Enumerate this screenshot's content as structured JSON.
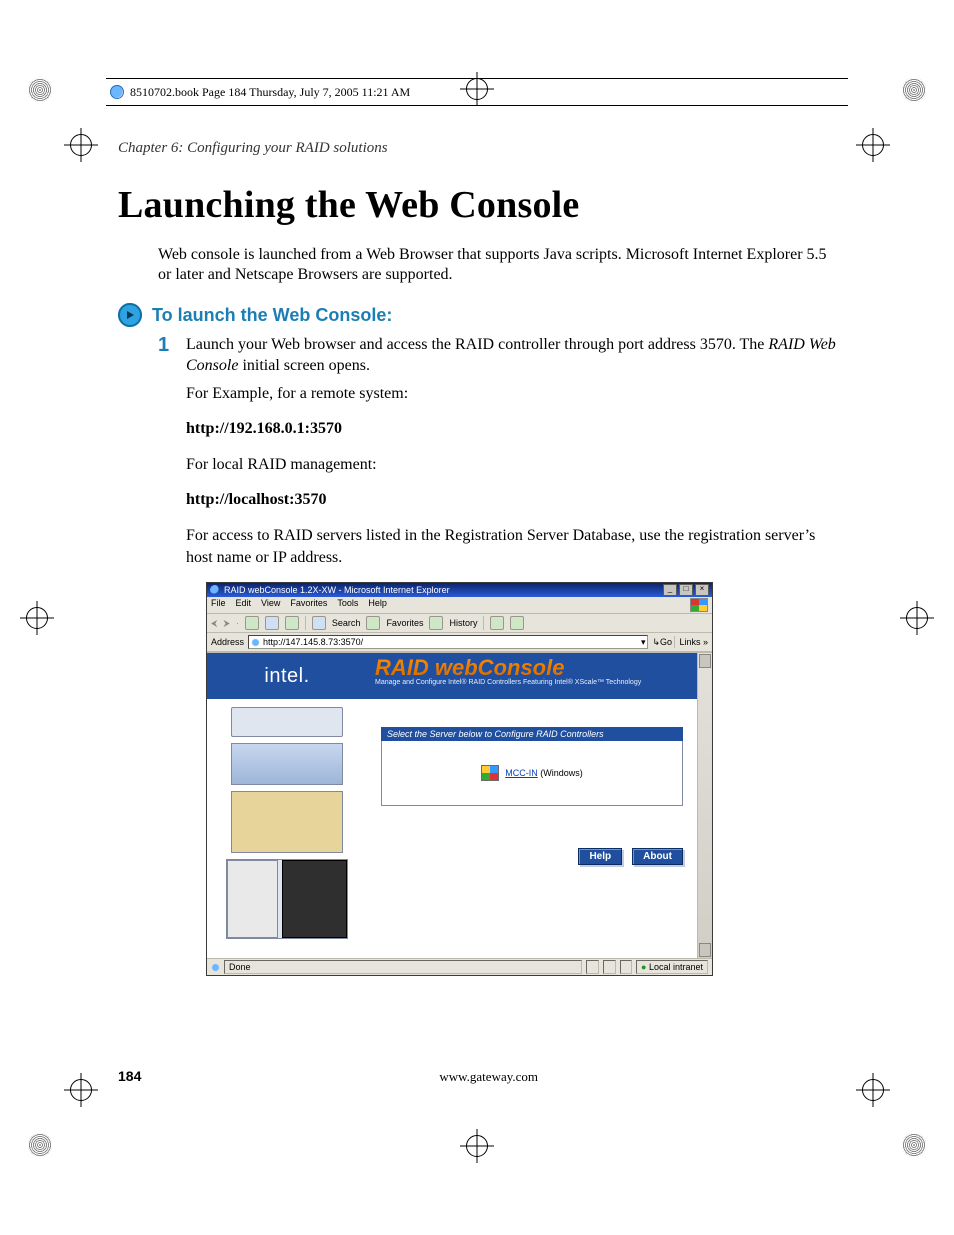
{
  "runhead": {
    "text": "8510702.book  Page 184  Thursday, July 7, 2005  11:21 AM"
  },
  "chapter": "Chapter 6: Configuring your RAID solutions",
  "title": "Launching the Web Console",
  "intro": "Web console is launched from a Web Browser that supports Java scripts. Microsoft Internet Explorer 5.5 or later and Netscape Browsers are supported.",
  "subhead": "To launch the Web Console:",
  "step1": {
    "num": "1",
    "lead": "Launch your Web browser and access the RAID controller through port address 3570. The ",
    "italic": "RAID Web Console",
    "tail": " initial screen opens."
  },
  "lines": {
    "example_label": "For Example, for a remote system:",
    "url_remote": "http://192.168.0.1:3570",
    "local_label": "For local RAID management:",
    "url_local": "http://localhost:3570",
    "reg": "For access to RAID servers listed in the Registration Server Database, use the registration server’s host name or IP address."
  },
  "screenshot": {
    "title": "RAID webConsole 1.2X-XW - Microsoft Internet Explorer",
    "menus": [
      "File",
      "Edit",
      "View",
      "Favorites",
      "Tools",
      "Help"
    ],
    "toolbar": {
      "search": "Search",
      "favorites": "Favorites",
      "history": "History"
    },
    "address_label": "Address",
    "address_value": "http://147.145.8.73:3570/",
    "go": "Go",
    "links": "Links »",
    "brand_left": "intel.",
    "brand_logo": "RAID webConsole",
    "brand_tag": "Manage and Configure Intel® RAID Controllers Featuring Intel® XScale™ Technology",
    "panel_title": "Select the Server below to Configure RAID Controllers",
    "server_link": "MCC-IN",
    "server_suffix": " (Windows)",
    "buttons": {
      "help": "Help",
      "about": "About"
    },
    "status_done": "Done",
    "status_zone": "Local intranet"
  },
  "footer": {
    "page": "184",
    "url": "www.gateway.com"
  }
}
